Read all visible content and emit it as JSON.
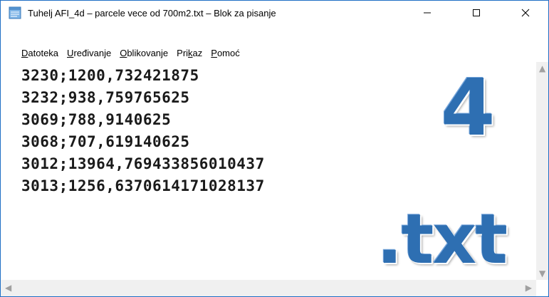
{
  "window": {
    "title": "Tuhelj AFI_4d – parcele vece od 700m2.txt – Blok za pisanje",
    "border_color": "#1f6fc5"
  },
  "titlebar_buttons": {
    "minimize_icon": "minimize-icon",
    "maximize_icon": "maximize-icon",
    "close_icon": "close-icon"
  },
  "menu": [
    {
      "label_ul": "D",
      "label_rest": "atoteka"
    },
    {
      "label_ul": "U",
      "label_rest": "ređivanje"
    },
    {
      "label_ul": "O",
      "label_rest": "blikovanje"
    },
    {
      "label_pre": "Pri",
      "label_ul": "k",
      "label_rest": "az"
    },
    {
      "label_ul": "P",
      "label_rest": "omoć"
    }
  ],
  "content": {
    "lines": [
      "3230;1200,732421875",
      "3232;938,759765625",
      "3069;788,9140625",
      "3068;707,619140625",
      "3012;13964,769433856010437",
      "3013;1256,6370614171028137"
    ]
  },
  "overlay": {
    "number": "4",
    "extension": ".txt",
    "color": "#2e6fb2"
  },
  "scrollbars": {
    "up_icon": "scroll-up-icon",
    "down_icon": "scroll-down-icon",
    "left_icon": "scroll-left-icon",
    "right_icon": "scroll-right-icon"
  }
}
